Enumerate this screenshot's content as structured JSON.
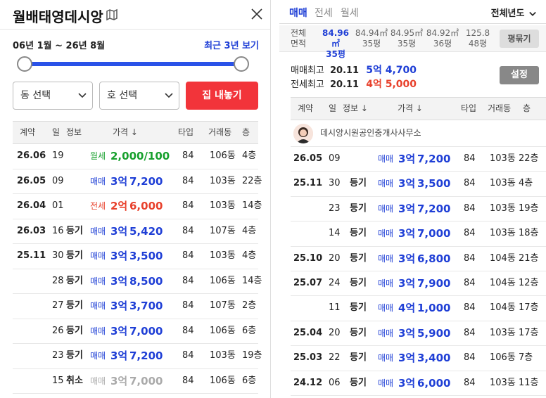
{
  "left": {
    "title": "월배태영데시앙",
    "range_text": "06년 1월 ~ 26년 8월",
    "recent_link": "최근 3년 보기",
    "dong_select": "동 선택",
    "ho_select": "호 선택",
    "cta_button": "집 내놓기",
    "headers": {
      "contract": "계약",
      "day": "일",
      "info": "정보",
      "price": "가격 ↓",
      "type": "타입",
      "dong": "거래동",
      "floor": "층"
    },
    "rows": [
      {
        "ym": "26.06",
        "day": "19",
        "info": "",
        "kind": "월세",
        "price_a": "2,000/100",
        "price_b": "",
        "color": "green",
        "type": "84",
        "dong": "106동",
        "floor": "4층"
      },
      {
        "ym": "26.05",
        "day": "09",
        "info": "",
        "kind": "매매",
        "price_a": "3억",
        "price_b": "7,200",
        "color": "blue",
        "type": "84",
        "dong": "103동",
        "floor": "22층"
      },
      {
        "ym": "26.04",
        "day": "01",
        "info": "",
        "kind": "전세",
        "price_a": "2억",
        "price_b": "6,000",
        "color": "red",
        "type": "84",
        "dong": "103동",
        "floor": "14층"
      },
      {
        "ym": "26.03",
        "day": "16",
        "info": "등기",
        "kind": "매매",
        "price_a": "3억",
        "price_b": "5,420",
        "color": "blue",
        "type": "84",
        "dong": "107동",
        "floor": "4층"
      },
      {
        "ym": "25.11",
        "day": "30",
        "info": "등기",
        "kind": "매매",
        "price_a": "3억",
        "price_b": "3,500",
        "color": "blue",
        "type": "84",
        "dong": "103동",
        "floor": "4층"
      },
      {
        "ym": "",
        "day": "28",
        "info": "등기",
        "kind": "매매",
        "price_a": "3억",
        "price_b": "8,500",
        "color": "blue",
        "type": "84",
        "dong": "106동",
        "floor": "14층"
      },
      {
        "ym": "",
        "day": "27",
        "info": "등기",
        "kind": "매매",
        "price_a": "3억",
        "price_b": "3,700",
        "color": "blue",
        "type": "84",
        "dong": "107동",
        "floor": "2층"
      },
      {
        "ym": "",
        "day": "26",
        "info": "등기",
        "kind": "매매",
        "price_a": "3억",
        "price_b": "7,000",
        "color": "blue",
        "type": "84",
        "dong": "106동",
        "floor": "6층"
      },
      {
        "ym": "",
        "day": "23",
        "info": "등기",
        "kind": "매매",
        "price_a": "3억",
        "price_b": "7,200",
        "color": "blue",
        "type": "84",
        "dong": "103동",
        "floor": "19층"
      },
      {
        "ym": "",
        "day": "15",
        "info": "취소",
        "kind": "매매",
        "price_a": "3억",
        "price_b": "7,000",
        "color": "gray",
        "type": "84",
        "dong": "106동",
        "floor": "6층"
      }
    ]
  },
  "right": {
    "tabs": [
      "매매",
      "전세",
      "월세"
    ],
    "year_filter": "전체년도",
    "area_label_1": "전체",
    "area_label_2": "면적",
    "areas": [
      {
        "m2": "84.96㎡",
        "py": "35평",
        "active": true
      },
      {
        "m2": "84.94㎡",
        "py": "35평",
        "active": false
      },
      {
        "m2": "84.95㎡",
        "py": "35평",
        "active": false
      },
      {
        "m2": "84.92㎡",
        "py": "36평",
        "active": false
      },
      {
        "m2": "125.8",
        "py": "48평",
        "active": false
      }
    ],
    "pyeong_button": "평묶기",
    "sale_max_label": "매매최고",
    "sale_max_date": "20.11",
    "sale_max_price": "5억 4,700",
    "jeonse_max_label": "전세최고",
    "jeonse_max_date": "20.11",
    "jeonse_max_price": "4억 5,000",
    "settings_button": "설정",
    "headers": {
      "contract": "계약",
      "day": "일",
      "info": "정보 ↓",
      "price": "가격 ↓",
      "type": "타입",
      "dong": "거래동",
      "floor": "층"
    },
    "agent_name": "데시앙시원공인중개사사무소",
    "rows": [
      {
        "ym": "26.05",
        "day": "09",
        "info": "",
        "kind": "매매",
        "price_a": "3억",
        "price_b": "7,200",
        "type": "84",
        "dong": "103동",
        "floor": "22층"
      },
      {
        "ym": "25.11",
        "day": "30",
        "info": "등기",
        "kind": "매매",
        "price_a": "3억",
        "price_b": "3,500",
        "type": "84",
        "dong": "103동",
        "floor": "4층"
      },
      {
        "ym": "",
        "day": "23",
        "info": "등기",
        "kind": "매매",
        "price_a": "3억",
        "price_b": "7,200",
        "type": "84",
        "dong": "103동",
        "floor": "19층"
      },
      {
        "ym": "",
        "day": "14",
        "info": "등기",
        "kind": "매매",
        "price_a": "3억",
        "price_b": "7,000",
        "type": "84",
        "dong": "103동",
        "floor": "18층"
      },
      {
        "ym": "25.10",
        "day": "20",
        "info": "등기",
        "kind": "매매",
        "price_a": "3억",
        "price_b": "6,800",
        "type": "84",
        "dong": "104동",
        "floor": "21층"
      },
      {
        "ym": "25.07",
        "day": "24",
        "info": "등기",
        "kind": "매매",
        "price_a": "3억",
        "price_b": "7,900",
        "type": "84",
        "dong": "104동",
        "floor": "12층"
      },
      {
        "ym": "",
        "day": "11",
        "info": "등기",
        "kind": "매매",
        "price_a": "4억",
        "price_b": "1,000",
        "type": "84",
        "dong": "104동",
        "floor": "17층"
      },
      {
        "ym": "25.04",
        "day": "20",
        "info": "등기",
        "kind": "매매",
        "price_a": "3억",
        "price_b": "5,900",
        "type": "84",
        "dong": "103동",
        "floor": "17층"
      },
      {
        "ym": "25.03",
        "day": "22",
        "info": "등기",
        "kind": "매매",
        "price_a": "3억",
        "price_b": "3,400",
        "type": "84",
        "dong": "106동",
        "floor": "7층"
      },
      {
        "ym": "24.12",
        "day": "06",
        "info": "등기",
        "kind": "매매",
        "price_a": "3억",
        "price_b": "6,000",
        "type": "84",
        "dong": "103동",
        "floor": "11층"
      }
    ]
  },
  "colors": {
    "blue": "#1f3fd6",
    "red": "#e8412c",
    "green": "#17a02d",
    "cta": "#f2343a"
  },
  "icons": {
    "map": "map-icon",
    "close": "close-icon",
    "chevron": "chevron-down-icon"
  }
}
